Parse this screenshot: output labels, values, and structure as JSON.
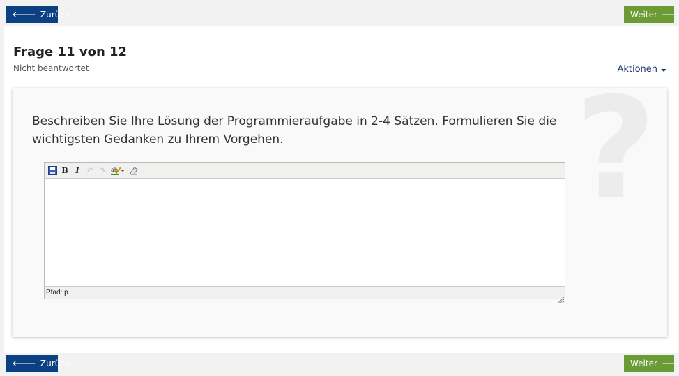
{
  "nav": {
    "back_label": "Zurück",
    "next_label": "Weiter"
  },
  "question": {
    "title": "Frage 11 von 12",
    "status": "Nicht beantwortet",
    "actions_label": "Aktionen",
    "text": "Beschreiben Sie Ihre Lösung der Programmieraufgabe in 2-4 Sätzen. Formulieren Sie die wichtigsten Gedanken zu Ihrem Vorgehen.",
    "watermark": "?"
  },
  "editor": {
    "toolbar_icons": [
      "save-icon",
      "bold-icon",
      "italic-icon",
      "undo-icon",
      "redo-icon",
      "spellcheck-icon",
      "eraser-icon"
    ],
    "bold_glyph": "B",
    "italic_glyph": "I",
    "path_label": "Pfad: p"
  },
  "colors": {
    "back_button": "#0b4182",
    "next_button": "#6a9b35"
  }
}
